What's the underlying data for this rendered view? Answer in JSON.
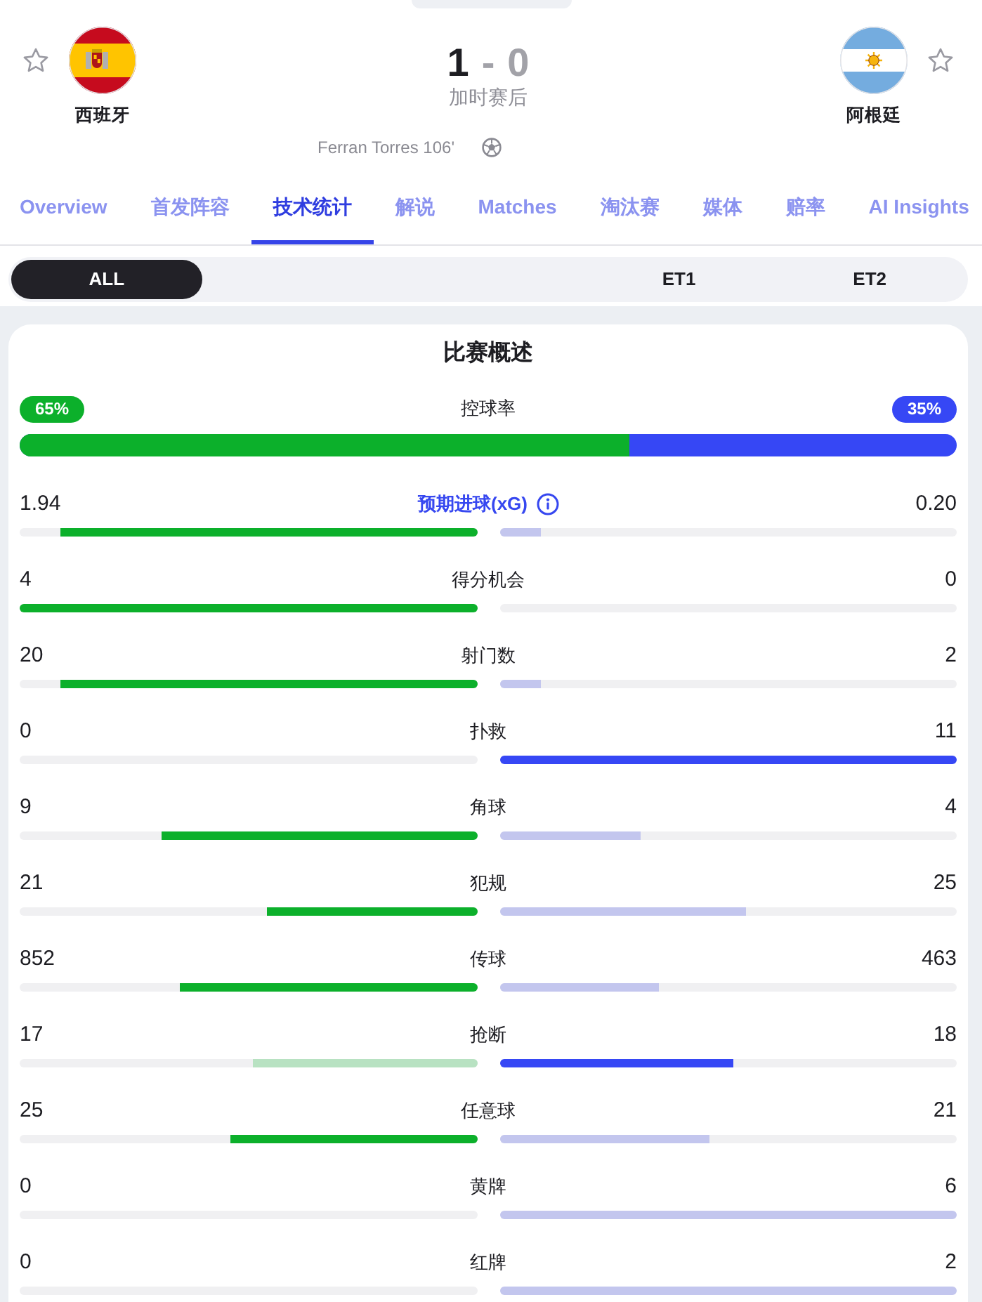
{
  "header": {
    "home": {
      "name": "西班牙",
      "flag": {
        "kind": "spain"
      },
      "favorite": false,
      "scorers": [
        "Ferran Torres 106'"
      ]
    },
    "away": {
      "name": "阿根廷",
      "flag": {
        "kind": "argentina"
      },
      "favorite": false
    },
    "score": {
      "home": {
        "value": "1",
        "winning": true
      },
      "separator": "-",
      "away": {
        "value": "0",
        "winning": false
      }
    },
    "status": "加时赛后"
  },
  "tabs": [
    {
      "label": "Overview",
      "selected": false
    },
    {
      "label": "首发阵容",
      "selected": false
    },
    {
      "label": "技术统计",
      "selected": true
    },
    {
      "label": "解说",
      "selected": false
    },
    {
      "label": "Matches",
      "selected": false
    },
    {
      "label": "淘汰赛",
      "selected": false
    },
    {
      "label": "媒体",
      "selected": false
    },
    {
      "label": "赔率",
      "selected": false
    },
    {
      "label": "AI Insights",
      "selected": false
    }
  ],
  "periods": [
    {
      "label": "ALL",
      "selected": true
    },
    {
      "label": "ET1",
      "selected": false
    },
    {
      "label": "ET2",
      "selected": false
    }
  ],
  "overview": {
    "title": "比赛概述",
    "possession": {
      "label": "控球率",
      "home": "65%",
      "away": "35%",
      "level": 0.65
    },
    "stats": [
      {
        "label": "预期进球(xG)",
        "kind": "info",
        "home": {
          "value": "1.94",
          "level": 0.91,
          "leading": true
        },
        "away": {
          "value": "0.20",
          "level": 0.09,
          "leading": false
        }
      },
      {
        "label": "得分机会",
        "kind": "plain",
        "home": {
          "value": "4",
          "level": 1,
          "leading": true
        },
        "away": {
          "value": "0"
        }
      },
      {
        "label": "射门数",
        "kind": "plain",
        "home": {
          "value": "20",
          "level": 0.91,
          "leading": true
        },
        "away": {
          "value": "2",
          "level": 0.09,
          "leading": false
        }
      },
      {
        "label": "扑救",
        "kind": "plain",
        "home": {
          "value": "0"
        },
        "away": {
          "value": "11",
          "level": 1,
          "leading": true
        }
      },
      {
        "label": "角球",
        "kind": "plain",
        "home": {
          "value": "9",
          "level": 0.69,
          "leading": true
        },
        "away": {
          "value": "4",
          "level": 0.31,
          "leading": false
        }
      },
      {
        "label": "犯规",
        "kind": "plain",
        "home": {
          "value": "21",
          "level": 0.46,
          "leading": true
        },
        "away": {
          "value": "25",
          "level": 0.54,
          "leading": false
        }
      },
      {
        "label": "传球",
        "kind": "plain",
        "home": {
          "value": "852",
          "level": 0.65,
          "leading": true
        },
        "away": {
          "value": "463",
          "level": 0.35,
          "leading": false
        }
      },
      {
        "label": "抢断",
        "kind": "plain",
        "home": {
          "value": "17",
          "level": 0.49,
          "leading": false
        },
        "away": {
          "value": "18",
          "level": 0.51,
          "leading": true
        }
      },
      {
        "label": "任意球",
        "kind": "plain",
        "home": {
          "value": "25",
          "level": 0.54,
          "leading": true
        },
        "away": {
          "value": "21",
          "level": 0.46,
          "leading": false
        }
      },
      {
        "label": "黄牌",
        "kind": "plain",
        "home": {
          "value": "0"
        },
        "away": {
          "value": "6",
          "level": 1,
          "leading": false
        }
      },
      {
        "label": "红牌",
        "kind": "plain",
        "home": {
          "value": "0"
        },
        "away": {
          "value": "2",
          "level": 1,
          "leading": false
        }
      }
    ]
  }
}
